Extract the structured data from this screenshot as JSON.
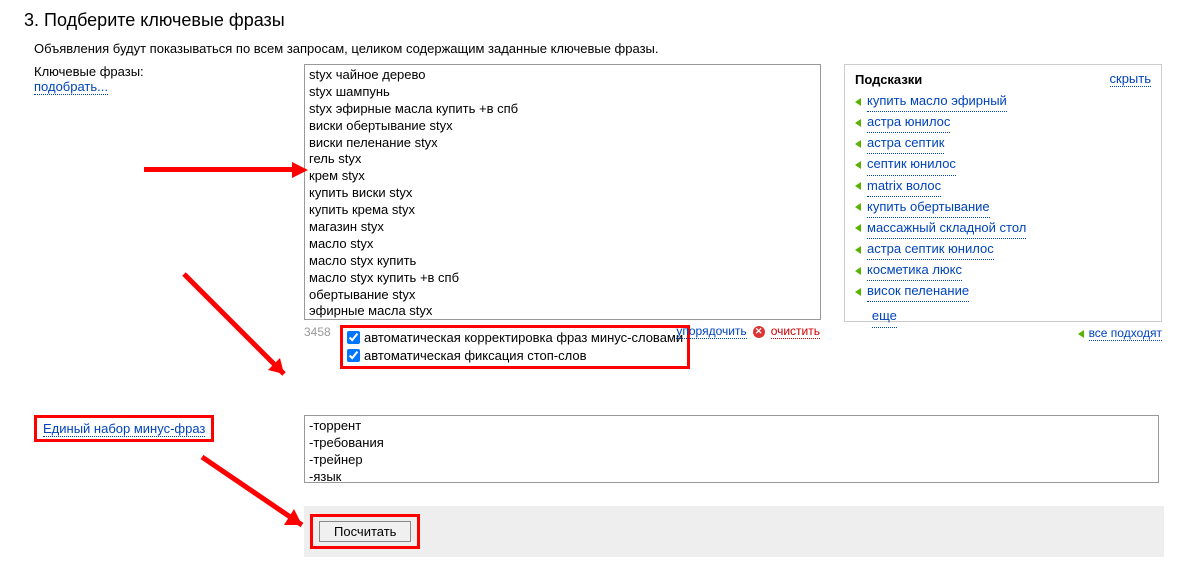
{
  "heading": "3. Подберите ключевые фразы",
  "subtitle": "Объявления будут показываться по всем запросам, целиком содержащим заданные ключевые фразы.",
  "keywords_label": "Ключевые фразы:",
  "pick_link": "подобрать...",
  "keywords_text": "styx чайное дерево\nstyx шампунь\nstyx эфирные масла купить +в спб\nвиски обертывание styx\nвиски пеленание styx\nгель styx\nкрем styx\nкупить виски styx\nкупить крема styx\nмагазин styx\nмасло styx\nмасло styx купить\nмасло styx купить +в спб\nобертывание styx\nэфирные масла styx\nэфирные масла styx купить",
  "char_count": "3458",
  "order_link": "упорядочить",
  "clear_link": "очистить",
  "auto_minus_label": "автоматическая корректировка фраз минус-словами",
  "auto_stop_label": "автоматическая фиксация стоп-слов",
  "hints_title": "Подсказки",
  "hide_link": "скрыть",
  "hints": {
    "0": "купить масло эфирный",
    "1": "астра юнилос",
    "2": "астра септик",
    "3": "септик юнилос",
    "4": "matrix волос",
    "5": "купить обертывание",
    "6": "массажный складной стол",
    "7": "астра септик юнилос",
    "8": "косметика люкс",
    "9": "висок пеленание"
  },
  "more_link": "еще",
  "all_fit": "все подходят",
  "minus_set_link": "Единый набор минус-фраз",
  "minus_text": "-торрент\n-требования\n-трейнер\n-язык",
  "calc_label": "Посчитать"
}
